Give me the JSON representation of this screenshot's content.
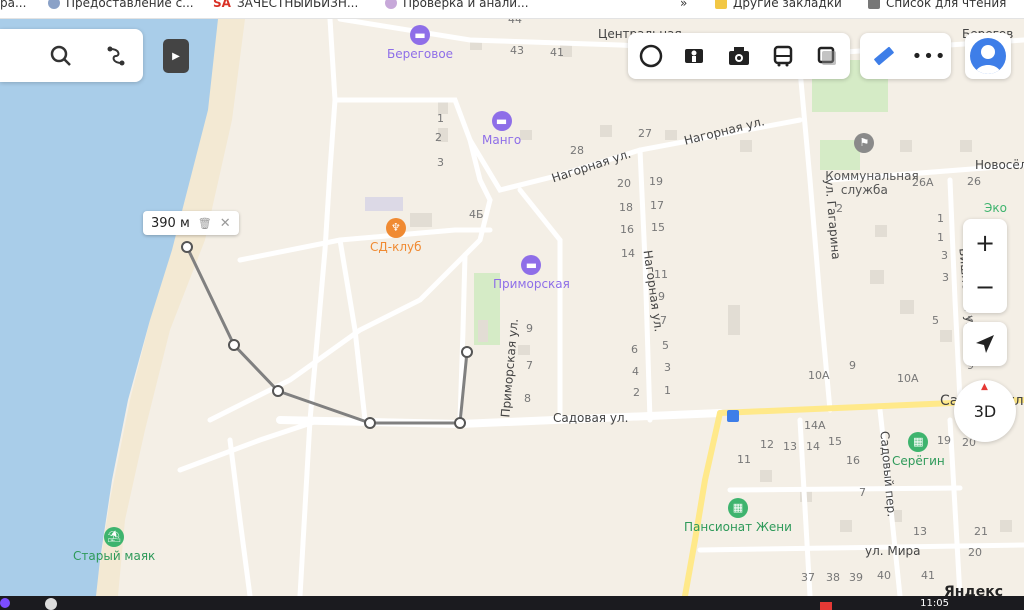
{
  "bookmarks": {
    "items": [
      "ра...",
      "Предоставление с...",
      "ЗАЧЕСТНЫЙБИЗН...",
      "Проверка и анали...",
      "»",
      "Другие закладки",
      "Список для чтения"
    ],
    "sa_prefix": "SA"
  },
  "map": {
    "pois": {
      "beregovoe": "Береговое",
      "mango": "Манго",
      "sd_club": "СД-клуб",
      "primorskaya": "Приморская",
      "kommunal": "Коммунальная\nслужба",
      "seregin": "Серёгин",
      "pansionat": "Пансионат Жени",
      "stary_mayak": "Старый маяк"
    },
    "streets": {
      "nagornaya1": "Нагорная ул.",
      "nagornaya2": "Нагорная ул.",
      "nagornaya_v": "Нагорная ул.",
      "primorskaya_v": "Приморская ул.",
      "sadovaya": "Садовая ул.",
      "sadovaya_right": "Садовая ул.",
      "gagarina": "ул. Гагарина",
      "vishnevaya": "Вишнёвая ул.",
      "sadovy_per": "Садовый пер.",
      "mira": "ул. Мира",
      "novosel": "Новосёл",
      "centralnaya": "Центральная",
      "beregovaya": "Берегов"
    },
    "house_numbers": [
      "44",
      "43",
      "41",
      "1",
      "2",
      "3",
      "4Б",
      "28",
      "27",
      "20",
      "18",
      "16",
      "14",
      "19",
      "17",
      "15",
      "11",
      "9",
      "7",
      "5",
      "3",
      "1",
      "6",
      "4",
      "2",
      "9",
      "7",
      "8",
      "2",
      "1",
      "3",
      "5",
      "9",
      "10А",
      "26А",
      "26",
      "1",
      "3",
      "5",
      "9",
      "10А",
      "14А",
      "12",
      "13",
      "14",
      "15",
      "16",
      "11",
      "7",
      "19",
      "20",
      "13",
      "21",
      "37",
      "38",
      "39",
      "40",
      "41",
      "20"
    ],
    "measure": {
      "distance": "390 м"
    },
    "brand": "Яндекс"
  },
  "controls": {
    "zoom_in": "+",
    "zoom_out": "−",
    "three_d": "3D",
    "eco": "Эко"
  },
  "taskbar": {
    "clock": "11:05"
  },
  "colors": {
    "water": "#a9cde9",
    "beach": "#f3e9d3",
    "land": "#f4efe6",
    "road": "#ffffff",
    "main_road": "#ffe98a",
    "route": "#888888",
    "accent_blue": "#3e7ee8",
    "poi_purple": "#8e6ee8",
    "poi_orange": "#f08a32",
    "poi_green": "#3eb46e"
  }
}
